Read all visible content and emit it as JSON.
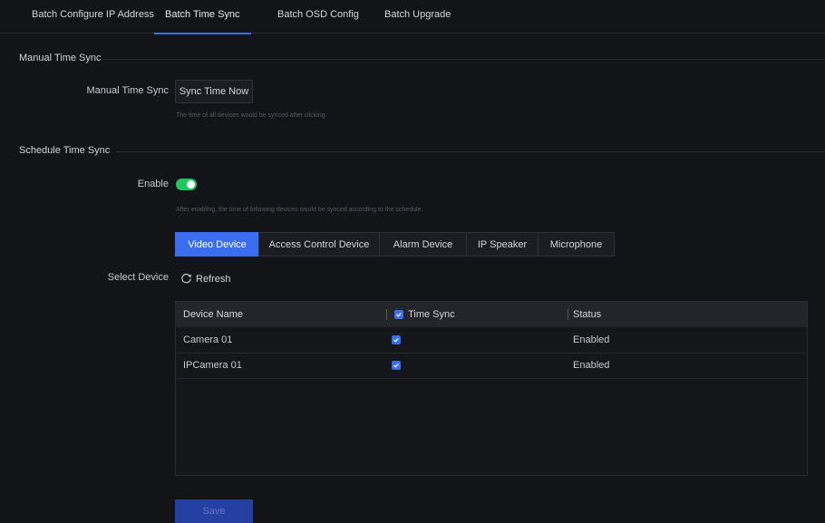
{
  "tabs": [
    {
      "label": "Batch Configure IP Address"
    },
    {
      "label": "Batch Time Sync"
    },
    {
      "label": "Batch OSD Config"
    },
    {
      "label": "Batch Upgrade"
    }
  ],
  "active_tab": "Batch Time Sync",
  "manual": {
    "section_title": "Manual Time Sync",
    "label": "Manual Time Sync",
    "button": "Sync Time Now",
    "hint": "The time of all devices would be synced after clicking."
  },
  "schedule": {
    "section_title": "Schedule Time Sync",
    "enable_label": "Enable",
    "enabled": true,
    "hint": "After enabling, the time of following devices would be synced according to the schedule.",
    "device_tabs": [
      "Video Device",
      "Access Control Device",
      "Alarm Device",
      "IP Speaker",
      "Microphone"
    ],
    "active_device_tab": "Video Device",
    "select_label": "Select Device",
    "refresh": "Refresh"
  },
  "table": {
    "headers": {
      "name": "Device Name",
      "sync": "Time Sync",
      "status": "Status"
    },
    "header_checked": true,
    "rows": [
      {
        "name": "Camera 01",
        "checked": true,
        "status": "Enabled"
      },
      {
        "name": "IPCamera 01",
        "checked": true,
        "status": "Enabled"
      }
    ]
  },
  "save_button": "Save",
  "colors": {
    "accent": "#3a6df0",
    "toggle_on": "#22c55e",
    "background": "#131418"
  }
}
